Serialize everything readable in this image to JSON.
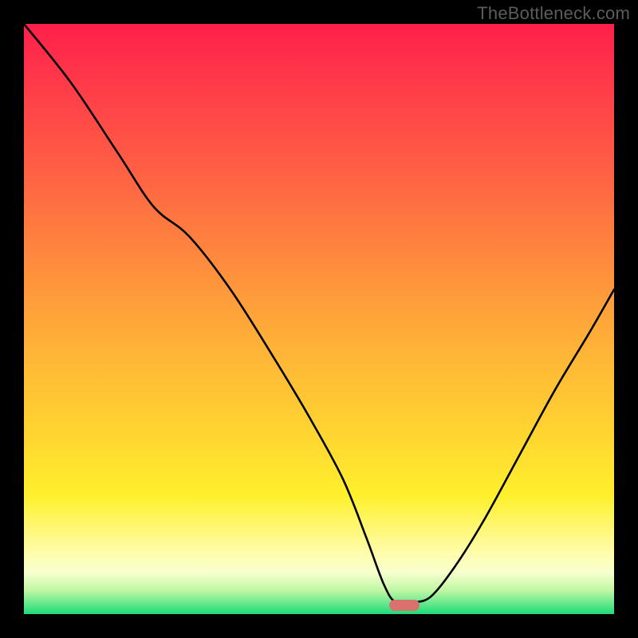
{
  "watermark": "TheBottleneck.com",
  "gradient": {
    "top": "#ff1f4b",
    "upper_mid": "#ff8a3e",
    "mid": "#ffd631",
    "lower_mid": "#fffdb0",
    "bottom": "#1edb7a"
  },
  "marker": {
    "color": "#d9716e",
    "x_frac": 0.645,
    "y_frac": 0.985
  },
  "chart_data": {
    "type": "line",
    "title": "",
    "xlabel": "",
    "ylabel": "",
    "xlim": [
      0,
      1
    ],
    "ylim": [
      0,
      1
    ],
    "legend": false,
    "grid": false,
    "description": "Bottleneck-style V-curve on heat gradient; x is a normalized parameter sweep, y is normalized bottleneck/mismatch (0 = ideal at bottom). Minimum at the marker around x≈0.645.",
    "series": [
      {
        "name": "bottleneck_curve",
        "color": "#000000",
        "x": [
          0.0,
          0.08,
          0.16,
          0.22,
          0.28,
          0.35,
          0.42,
          0.48,
          0.54,
          0.58,
          0.61,
          0.63,
          0.66,
          0.69,
          0.73,
          0.78,
          0.84,
          0.9,
          0.96,
          1.0
        ],
        "y": [
          1.0,
          0.9,
          0.78,
          0.69,
          0.64,
          0.55,
          0.44,
          0.34,
          0.23,
          0.13,
          0.05,
          0.02,
          0.02,
          0.03,
          0.08,
          0.16,
          0.27,
          0.38,
          0.48,
          0.55
        ],
        "marker_at_x": 0.645
      }
    ]
  }
}
